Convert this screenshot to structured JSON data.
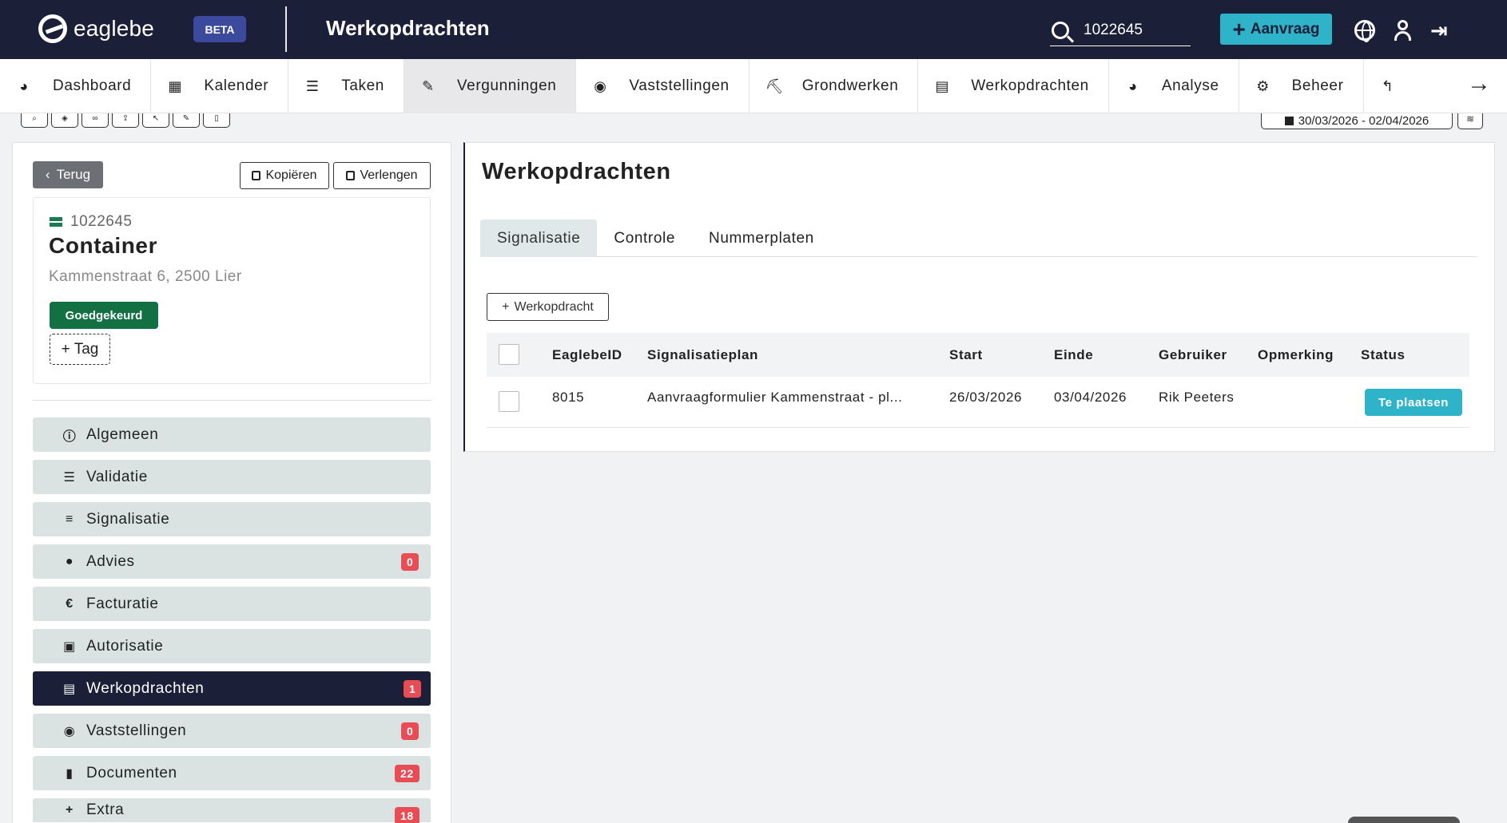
{
  "header": {
    "logo_text": "eaglebe",
    "beta_label": "BETA",
    "title": "Werkopdrachten",
    "search_value": "1022645",
    "new_request_label": "Aanvraag"
  },
  "nav": {
    "items": [
      {
        "icon": "dashboard-icon",
        "label": "Dashboard"
      },
      {
        "icon": "calendar-icon",
        "label": "Kalender"
      },
      {
        "icon": "tasks-icon",
        "label": "Taken"
      },
      {
        "icon": "permit-icon",
        "label": "Vergunningen",
        "active": true
      },
      {
        "icon": "eye-icon",
        "label": "Vaststellingen"
      },
      {
        "icon": "excavator-icon",
        "label": "Grondwerken"
      },
      {
        "icon": "document-icon",
        "label": "Werkopdrachten"
      },
      {
        "icon": "analytics-icon",
        "label": "Analyse"
      },
      {
        "icon": "gears-icon",
        "label": "Beheer"
      }
    ]
  },
  "map_toolbar": {
    "date_range": "30/03/2026 - 02/04/2026"
  },
  "left": {
    "back_label": "Terug",
    "copy_label": "Kopiëren",
    "extend_label": "Verlengen",
    "record": {
      "id": "1022645",
      "type": "Container",
      "address": "Kammenstraat 6, 2500 Lier",
      "status": "Goedgekeurd",
      "tag_label": "+ Tag"
    },
    "menu": [
      {
        "icon": "info-icon",
        "label": "Algemeen"
      },
      {
        "icon": "checklist-icon",
        "label": "Validatie"
      },
      {
        "icon": "signpost-icon",
        "label": "Signalisatie"
      },
      {
        "icon": "comment-icon",
        "label": "Advies",
        "badge": "0"
      },
      {
        "icon": "euro-icon",
        "label": "Facturatie"
      },
      {
        "icon": "authorization-icon",
        "label": "Autorisatie"
      },
      {
        "icon": "document-icon",
        "label": "Werkopdrachten",
        "badge": "1",
        "active": true
      },
      {
        "icon": "eye-icon",
        "label": "Vaststellingen",
        "badge": "0"
      },
      {
        "icon": "file-icon",
        "label": "Documenten",
        "badge": "22"
      },
      {
        "icon": "plus-icon",
        "label": "Extra",
        "badge": "18"
      }
    ]
  },
  "main": {
    "title": "Werkopdrachten",
    "tabs": [
      {
        "label": "Signalisatie",
        "active": true
      },
      {
        "label": "Controle"
      },
      {
        "label": "Nummerplaten"
      }
    ],
    "add_button_label": "Werkopdracht",
    "table": {
      "headers": [
        "EaglebeID",
        "Signalisatieplan",
        "Start",
        "Einde",
        "Gebruiker",
        "Opmerking",
        "Status"
      ],
      "rows": [
        {
          "id": "8015",
          "plan": "Aanvraagformulier Kammenstraat - pl...",
          "start": "26/03/2026",
          "end": "03/04/2026",
          "user": "Rik Peeters",
          "remark": "",
          "status": "Te plaatsen"
        }
      ]
    }
  },
  "colors": {
    "topbar": "#1b1f38",
    "accent": "#2fb3c8",
    "approved": "#127043",
    "badge": "#e84c55"
  }
}
